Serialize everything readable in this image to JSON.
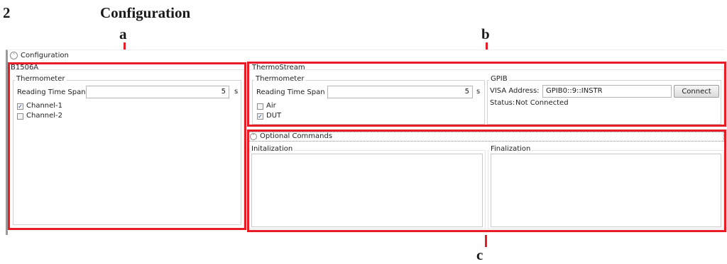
{
  "figure": {
    "number": "2",
    "title": "Configuration"
  },
  "callouts": {
    "a": "a",
    "b": "b",
    "c": "c"
  },
  "window": {
    "expander_label": "Configuration",
    "b1506a": {
      "title": "B1506A",
      "thermometer": {
        "title": "Thermometer",
        "reading_time_span_label": "Reading Time Span",
        "reading_time_span_value": "5",
        "unit": "s",
        "channels": [
          {
            "label": "Channel-1",
            "checked": true
          },
          {
            "label": "Channel-2",
            "checked": false
          }
        ]
      }
    },
    "thermostream": {
      "title": "ThermoStream",
      "thermometer": {
        "title": "Thermometer",
        "reading_time_span_label": "Reading Time Span",
        "reading_time_span_value": "5",
        "unit": "s",
        "options": [
          {
            "label": "Air",
            "checked": false
          },
          {
            "label": "DUT",
            "checked": true
          }
        ]
      },
      "gpib": {
        "title": "GPIB",
        "visa_address_label": "VISA Address:",
        "visa_address_value": "GPIB0::9::INSTR",
        "connect_label": "Connect",
        "status_label": "Status:",
        "status_value": "Not Connected"
      }
    },
    "optional_commands": {
      "expander_label": "Optional Commands",
      "initialization_label": "Initalization",
      "finalization_label": "Finalization",
      "initialization_text": "",
      "finalization_text": ""
    }
  },
  "colors": {
    "callout_red": "#e81c24",
    "window_edge": "#9a9a9a"
  }
}
